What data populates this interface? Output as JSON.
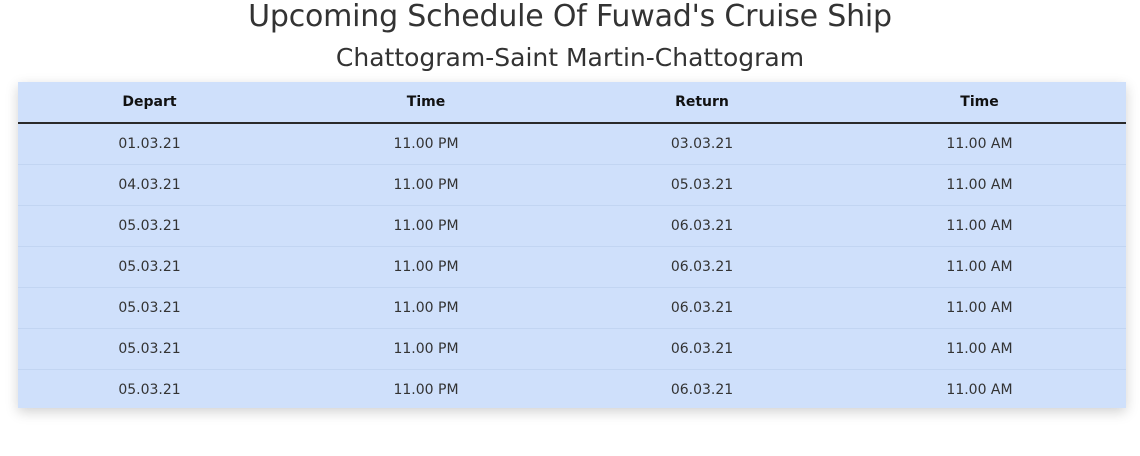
{
  "header": {
    "title": "Upcoming Schedule Of Fuwad's Cruise Ship",
    "subtitle": "Chattogram-Saint Martin-Chattogram"
  },
  "table": {
    "columns": [
      "Depart",
      "Time",
      "Return",
      "Time"
    ],
    "rows": [
      [
        "01.03.21",
        "11.00 PM",
        "03.03.21",
        "11.00 AM"
      ],
      [
        "04.03.21",
        "11.00 PM",
        "05.03.21",
        "11.00 AM"
      ],
      [
        "05.03.21",
        "11.00 PM",
        "06.03.21",
        "11.00 AM"
      ],
      [
        "05.03.21",
        "11.00 PM",
        "06.03.21",
        "11.00 AM"
      ],
      [
        "05.03.21",
        "11.00 PM",
        "06.03.21",
        "11.00 AM"
      ],
      [
        "05.03.21",
        "11.00 PM",
        "06.03.21",
        "11.00 AM"
      ],
      [
        "05.03.21",
        "11.00 PM",
        "06.03.21",
        "11.00 AM"
      ]
    ]
  },
  "colors": {
    "table_background": "#cfe0fb",
    "header_rule": "#2a2a2a"
  }
}
